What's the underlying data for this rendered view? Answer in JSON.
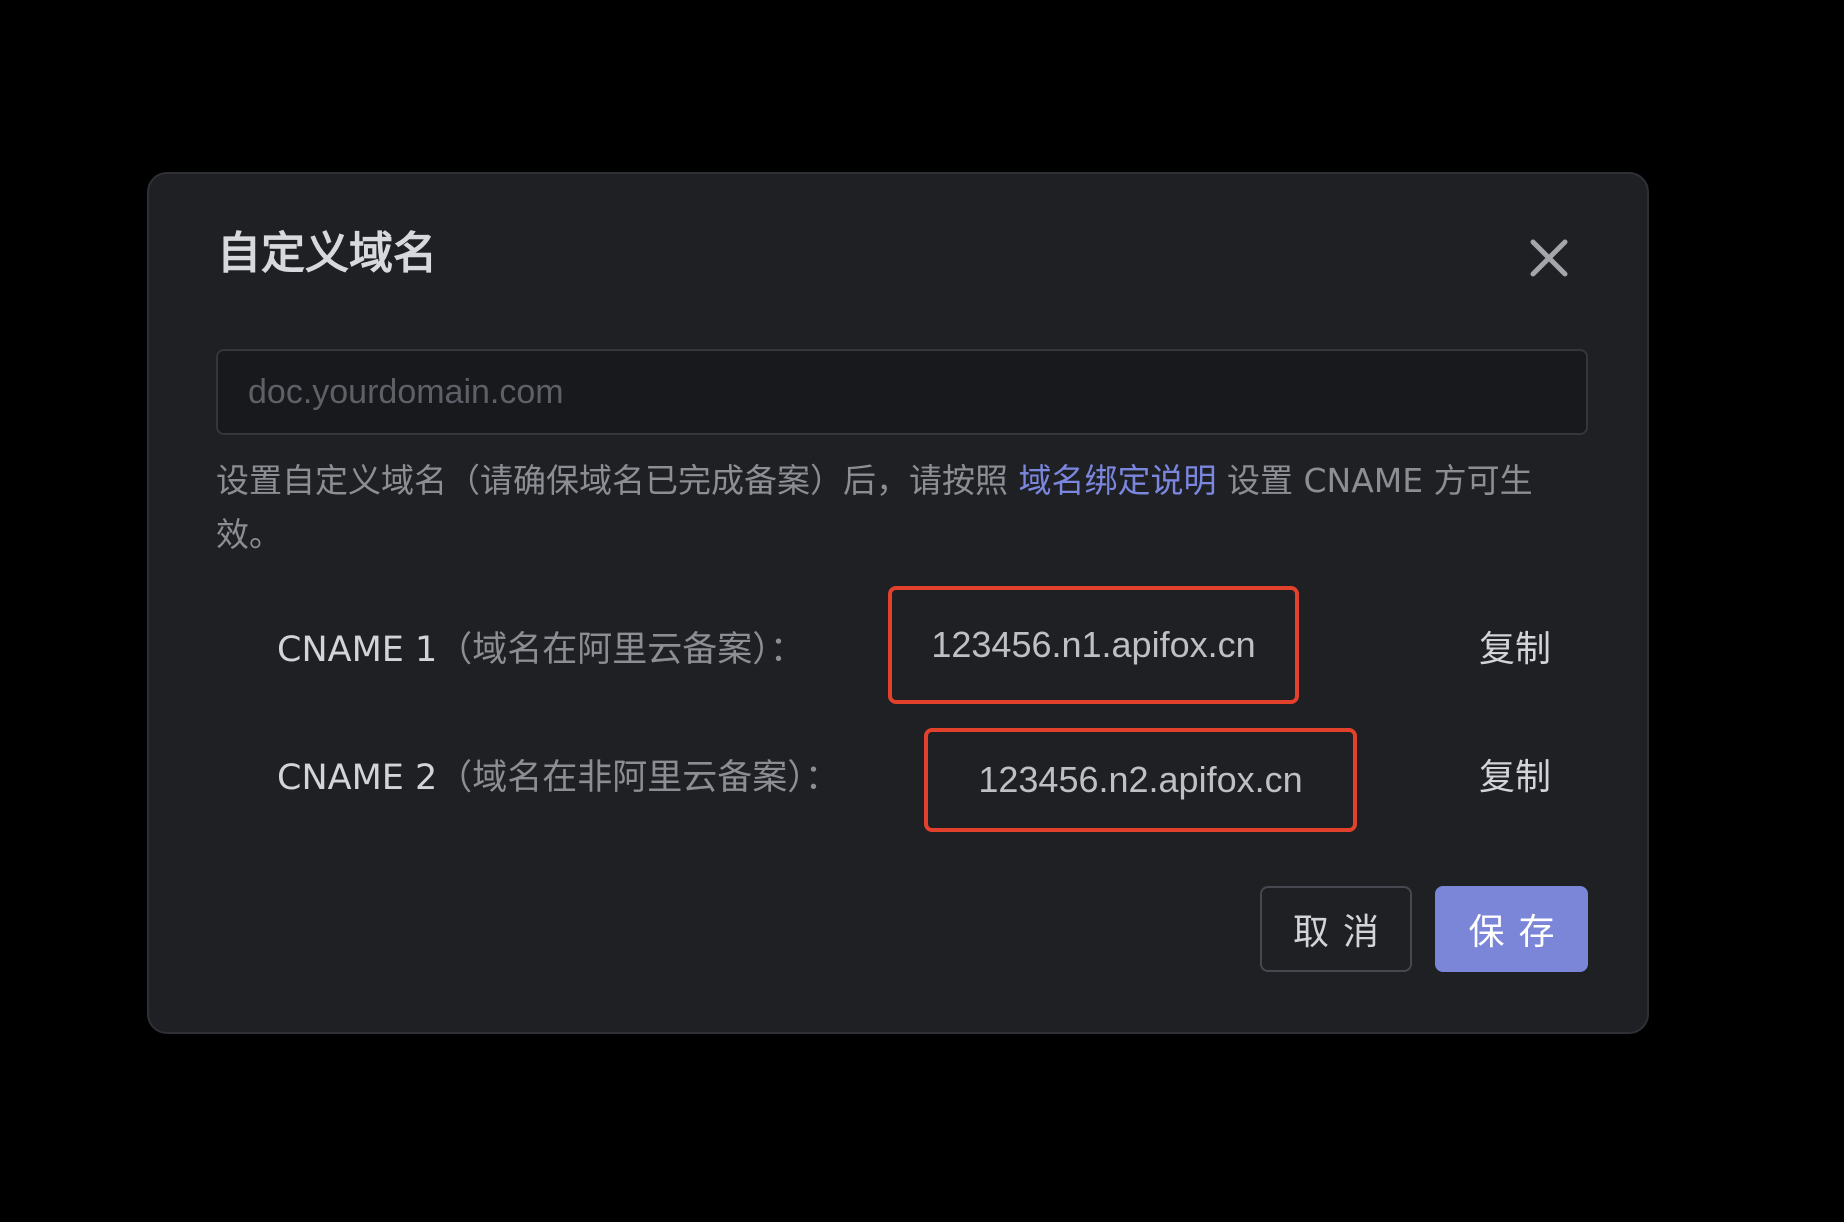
{
  "dialog": {
    "title": "自定义域名",
    "close_icon": "close-icon"
  },
  "domain_input": {
    "value": "",
    "placeholder": "doc.yourdomain.com"
  },
  "description": {
    "before_link": "设置自定义域名（请确保域名已完成备案）后，请按照 ",
    "link": "域名绑定说明",
    "after_link": " 设置 CNAME 方可生效。"
  },
  "cname_rows": [
    {
      "label_main": "CNAME 1",
      "label_sub": "（域名在阿里云备案）：",
      "value": "123456.n1.apifox.cn",
      "copy_label": "复制"
    },
    {
      "label_main": "CNAME 2",
      "label_sub": "（域名在非阿里云备案）：",
      "value": "123456.n2.apifox.cn",
      "copy_label": "复制"
    }
  ],
  "footer": {
    "cancel_label": "取消",
    "save_label": "保存"
  },
  "colors": {
    "modal_bg": "#1f2024",
    "accent": "#7b86d8",
    "link": "#7b86de",
    "highlight_border": "#e2412c"
  }
}
